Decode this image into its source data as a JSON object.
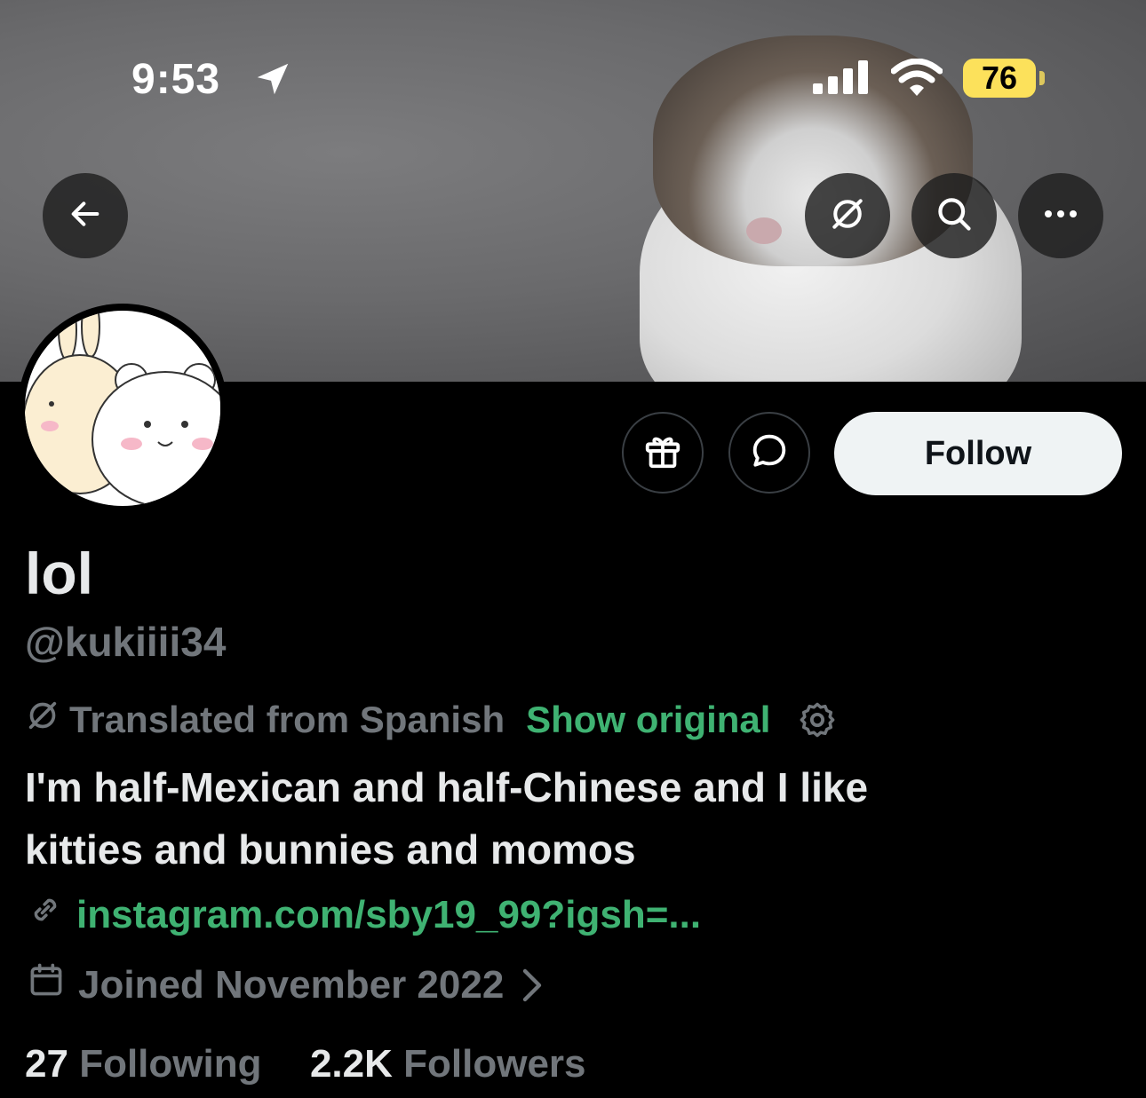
{
  "status_bar": {
    "time": "9:53",
    "battery": "76",
    "location_icon": "location-arrow-icon",
    "signal_icon": "cellular-signal-icon",
    "wifi_icon": "wifi-icon"
  },
  "banner": {
    "back_icon": "back-arrow-icon",
    "translate_icon": "translate-icon",
    "search_icon": "search-icon",
    "more_icon": "more-icon"
  },
  "actions": {
    "gift_icon": "gift-icon",
    "message_icon": "message-bubble-icon",
    "follow_label": "Follow"
  },
  "profile": {
    "display_name": "lol",
    "handle": "@kukiiii34",
    "translated_label": "Translated from Spanish",
    "show_original_label": "Show original",
    "bio_line1": "I'm half-Mexican and half-Chinese and I like",
    "bio_line2": "kitties and bunnies and momos",
    "link": "instagram.com/sby19_99?igsh=...",
    "joined": "Joined November 2022",
    "following_count": "27",
    "following_label": "Following",
    "followers_count": "2.2K",
    "followers_label": "Followers"
  },
  "colors": {
    "background": "#000000",
    "accent_green": "#3fb272",
    "secondary_text": "#71767b",
    "battery": "#fce15b"
  }
}
